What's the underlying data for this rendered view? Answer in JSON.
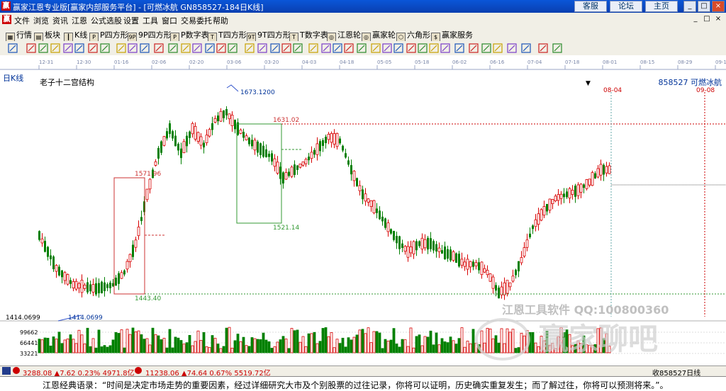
{
  "window": {
    "title": "赢家江恩专业版[赢家内部服务平台] - [可燃冰航  GN858527-184日K线]",
    "links": [
      "客服",
      "论坛",
      "主页"
    ],
    "controls": [
      "_",
      "□",
      "×"
    ]
  },
  "menu": {
    "logo": "赢",
    "items": [
      "文件",
      "浏览",
      "资讯",
      "江恩",
      "公式选股",
      "设置",
      "工具",
      "窗口",
      "交易委托",
      "帮助"
    ],
    "right_controls": [
      "_",
      "□",
      "×"
    ]
  },
  "toolbar": {
    "items": [
      {
        "label": "行情",
        "icon": "grid-icon"
      },
      {
        "label": "板块",
        "icon": "block-icon"
      },
      {
        "label": "K线",
        "icon": "kline-icon"
      },
      {
        "label": "P四方形",
        "icon": "P"
      },
      {
        "label": "9P四方形",
        "icon": "9P"
      },
      {
        "label": "P数字表",
        "icon": "P"
      },
      {
        "label": "T四方形",
        "icon": "T"
      },
      {
        "label": "9T四方形",
        "icon": "9T"
      },
      {
        "label": "T数字表",
        "icon": "T"
      },
      {
        "label": "江恩轮",
        "icon": "wheel-icon"
      },
      {
        "label": "赢家轮",
        "icon": "wheel-icon"
      },
      {
        "label": "六角形",
        "icon": "hex-icon"
      },
      {
        "label": "赢家服务",
        "icon": "dollar-icon"
      }
    ]
  },
  "timeline": {
    "dates": [
      "12-31",
      "12-30",
      "01-16",
      "02-06",
      "02-20",
      "03-06",
      "03-20",
      "04-03",
      "04-18",
      "05-05",
      "05-18",
      "06-02",
      "06-16",
      "07-04",
      "07-18",
      "08-01",
      "08-15",
      "08-29",
      "09-12"
    ]
  },
  "chart_header": {
    "period": "日K线",
    "indicator": "老子十二宫结构",
    "code_name": "858527  可燃冰航"
  },
  "chart_data": {
    "type": "candlestick",
    "annotations": {
      "high": "1673.1200",
      "low": "1414.0699",
      "low_axis": "1414.0699",
      "box1_top": "1571.96",
      "box1_bottom": "1443.40",
      "box2_top": "1631.02",
      "box2_bottom": "1521.14",
      "date_mark1": "08-04",
      "date_mark2": "09-08"
    },
    "volume_axis": [
      "99662",
      "66441",
      "33221"
    ],
    "colors": {
      "up": "#d80000",
      "down": "#008000",
      "box": "#cc3333",
      "box2": "#339933",
      "fib": "#cc0000"
    }
  },
  "watermark": {
    "line1": "江恩工具软件  QQ:100800360",
    "line2": "赢家聊吧"
  },
  "status": {
    "index1": "3288.08 ▲7.62 0.23% 4971.8亿",
    "index2": "11238.06 ▲74.64 0.67% 5519.72亿",
    "right": "收858527日线"
  },
  "footer": {
    "quote": "江恩经典语录：“时间是决定市场走势的重要因素，经过详细研究大市及个别股票的过往记录，你将可以证明，历史确实重复发生；而了解过往，你将可以预测将来。”。"
  }
}
